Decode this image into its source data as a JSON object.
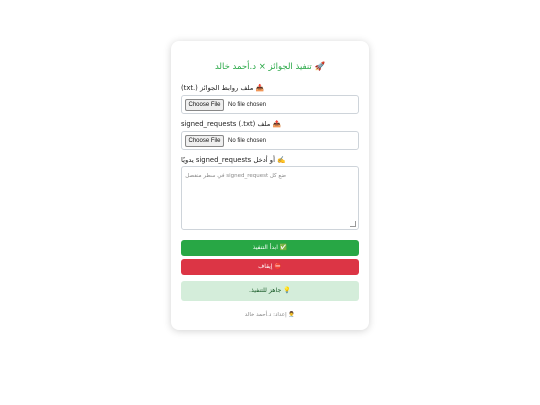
{
  "header": {
    "title": "تنفيذ الجوائز × د.أحمد خالد",
    "title_icon": "🚀",
    "accent_color": "#27a745"
  },
  "form": {
    "rewards_file": {
      "label": "ملف روابط الجوائز (.txt)",
      "icon": "📥",
      "button_label": "Choose File",
      "status_text": "No file chosen"
    },
    "signed_file": {
      "label": "ملف signed_requests (.txt)",
      "icon": "📤",
      "button_label": "Choose File",
      "status_text": "No file chosen"
    },
    "manual_input": {
      "label": "أو أدخل signed_requests يدويًا",
      "icon": "✍️",
      "placeholder": "ضع كل signed_request في سطر منفصل"
    }
  },
  "actions": {
    "start_label": "ابدأ التنفيذ",
    "start_icon": "✅",
    "start_color": "#28a745",
    "stop_label": "إيقاف",
    "stop_icon": "⛔",
    "stop_color": "#dc3545"
  },
  "status": {
    "text": "جاهز للتنفيذ.",
    "icon": "💡",
    "background": "#d4edda"
  },
  "footer": {
    "text": "إعداد: د.أحمد خالد",
    "icon": "👨‍⚕️"
  }
}
